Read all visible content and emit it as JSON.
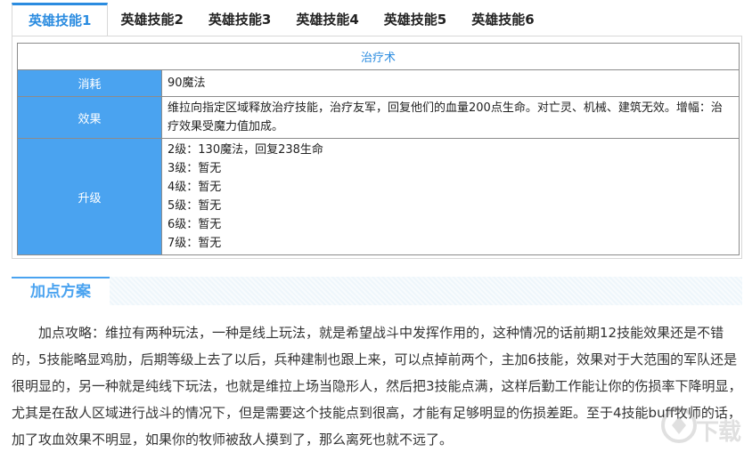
{
  "tabs": [
    {
      "label": "英雄技能1",
      "active": true
    },
    {
      "label": "英雄技能2",
      "active": false
    },
    {
      "label": "英雄技能3",
      "active": false
    },
    {
      "label": "英雄技能4",
      "active": false
    },
    {
      "label": "英雄技能5",
      "active": false
    },
    {
      "label": "英雄技能6",
      "active": false
    }
  ],
  "skill": {
    "title": "治疗术",
    "cost_label": "消耗",
    "cost_value": "90魔法",
    "effect_label": "效果",
    "effect_value": "维拉向指定区域释放治疗技能，治疗友军，回复他们的血量200点生命。对亡灵、机械、建筑无效。增幅：治疗效果受魔力值加成。",
    "upgrade_label": "升级",
    "levels": [
      "2级：130魔法，回复238生命",
      "3级：暂无",
      "4级：暂无",
      "5级：暂无",
      "6级：暂无",
      "7级：暂无"
    ]
  },
  "section": {
    "title": "加点方案"
  },
  "article": {
    "text": "加点攻略：维拉有两种玩法，一种是线上玩法，就是希望战斗中发挥作用的，这种情况的话前期12技能效果还是不错的，5技能略显鸡肋，后期等级上去了以后，兵种建制也跟上来，可以点掉前两个，主加6技能，效果对于大范围的军队还是很明显的，另一种就是纯线下玩法，也就是维拉上场当隐形人，然后把3技能点满，这样后勤工作能让你的伤损率下降明显，尤其是在敌人区域进行战斗的情况下，但是需要这个技能点到很高，才能有足够明显的伤损差距。至于4技能buff牧师的话，加了攻血效果不明显，如果你的牧师被敌人摸到了，那么离死也就不远了。"
  },
  "watermark": {
    "text": "下载"
  },
  "colors": {
    "accent": "#2b8ce0",
    "label_bg": "#4aa3f0"
  }
}
